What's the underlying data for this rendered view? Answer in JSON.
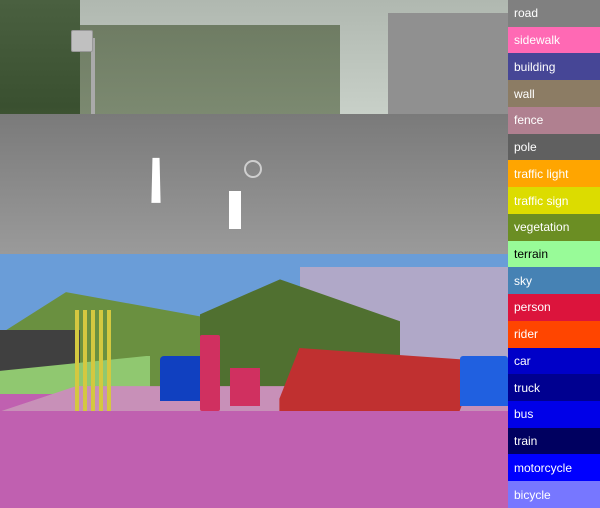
{
  "legend": {
    "items": [
      {
        "label": "road",
        "color": "#808080",
        "text_color": "white"
      },
      {
        "label": "sidewalk",
        "color": "#ff69b4",
        "text_color": "white"
      },
      {
        "label": "building",
        "color": "#464696",
        "text_color": "white"
      },
      {
        "label": "wall",
        "color": "#8c7c64",
        "text_color": "white"
      },
      {
        "label": "fence",
        "color": "#b08090",
        "text_color": "white"
      },
      {
        "label": "pole",
        "color": "#606060",
        "text_color": "white"
      },
      {
        "label": "traffic light",
        "color": "#ffa500",
        "text_color": "white"
      },
      {
        "label": "traffic sign",
        "color": "#dcdc00",
        "text_color": "white"
      },
      {
        "label": "vegetation",
        "color": "#6b8e23",
        "text_color": "white"
      },
      {
        "label": "terrain",
        "color": "#98fb98",
        "text_color": "black"
      },
      {
        "label": "sky",
        "color": "#4682b4",
        "text_color": "white"
      },
      {
        "label": "person",
        "color": "#dc143c",
        "text_color": "white"
      },
      {
        "label": "rider",
        "color": "#ff4500",
        "text_color": "white"
      },
      {
        "label": "car",
        "color": "#0000c8",
        "text_color": "white"
      },
      {
        "label": "truck",
        "color": "#000090",
        "text_color": "white"
      },
      {
        "label": "bus",
        "color": "#0000e8",
        "text_color": "white"
      },
      {
        "label": "train",
        "color": "#000060",
        "text_color": "white"
      },
      {
        "label": "motorcycle",
        "color": "#0000ff",
        "text_color": "white"
      },
      {
        "label": "bicycle",
        "color": "#7777ff",
        "text_color": "white"
      }
    ]
  },
  "top_image_alt": "Road scene photograph",
  "bottom_image_alt": "Semantic segmentation map"
}
